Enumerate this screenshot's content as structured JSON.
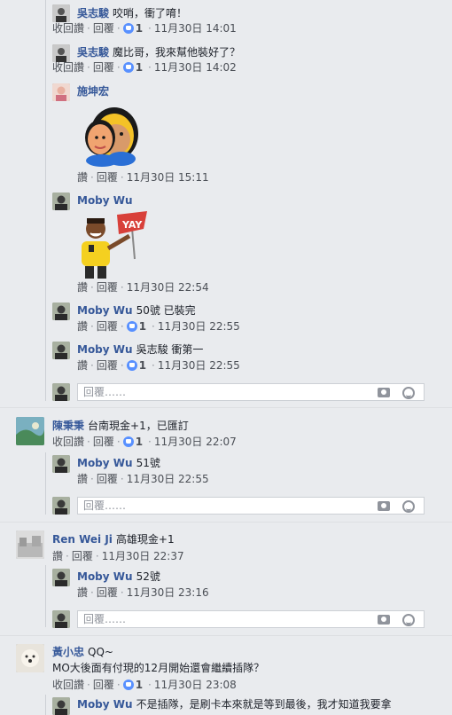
{
  "colors": {
    "background": "#e9ebee",
    "author": "#365899",
    "text": "#1d2129",
    "meta": "#4b4f56",
    "like_badge": "#5890ff"
  },
  "reply_placeholder": "回覆……",
  "icons": {
    "like": "like-badge-icon",
    "camera": "camera-icon",
    "emoji": "emoji-icon",
    "sticker_1": "monkey-sticker",
    "sticker_2": "yay-sticker"
  },
  "comments": [
    {
      "author": "吳志駿",
      "text": "咬哨，衝了唷！",
      "action1": "收回讚",
      "action2": "回覆",
      "likes": "1",
      "time": "11月30日 14:01"
    },
    {
      "author": "吳志駿",
      "text": "魔比哥，我來幫他裝好了？",
      "action1": "收回讚",
      "action2": "回覆",
      "likes": "1",
      "time": "11月30日 14:02"
    },
    {
      "author": "施坤宏",
      "text": "",
      "action1": "讚",
      "action2": "回覆",
      "likes": "",
      "time": "11月30日 15:11"
    },
    {
      "author": "Moby Wu",
      "text": "",
      "action1": "讚",
      "action2": "回覆",
      "likes": "",
      "time": "11月30日 22:54"
    },
    {
      "author": "Moby Wu",
      "text": "50號 已裝完",
      "action1": "讚",
      "action2": "回覆",
      "likes": "1",
      "time": "11月30日 22:55"
    },
    {
      "author": "Moby Wu",
      "text": "吳志駿 衝第一",
      "action1": "讚",
      "action2": "回覆",
      "likes": "1",
      "time": "11月30日 22:55"
    },
    {
      "author": "陳秉秉",
      "text": "台南現金+1，已匯訂",
      "action1": "收回讚",
      "action2": "回覆",
      "likes": "1",
      "time": "11月30日 22:07"
    },
    {
      "author": "Moby Wu",
      "text": "51號",
      "action1": "讚",
      "action2": "回覆",
      "likes": "",
      "time": "11月30日 22:55"
    },
    {
      "author": "Ren Wei Ji",
      "text": "高雄現金+1",
      "action1": "讚",
      "action2": "回覆",
      "likes": "",
      "time": "11月30日 22:37"
    },
    {
      "author": "Moby Wu",
      "text": "52號",
      "action1": "讚",
      "action2": "回覆",
      "likes": "",
      "time": "11月30日 23:16"
    },
    {
      "author": "黃小忠",
      "text": "QQ~",
      "text2": "MO大後面有付現的12月開始還會繼續插隊？",
      "action1": "收回讚",
      "action2": "回覆",
      "likes": "1",
      "time": "11月30日 23:08"
    },
    {
      "author": "Moby Wu",
      "text": "不是插隊，是刷卡本來就是等到最後，我才知道我要拿"
    }
  ]
}
